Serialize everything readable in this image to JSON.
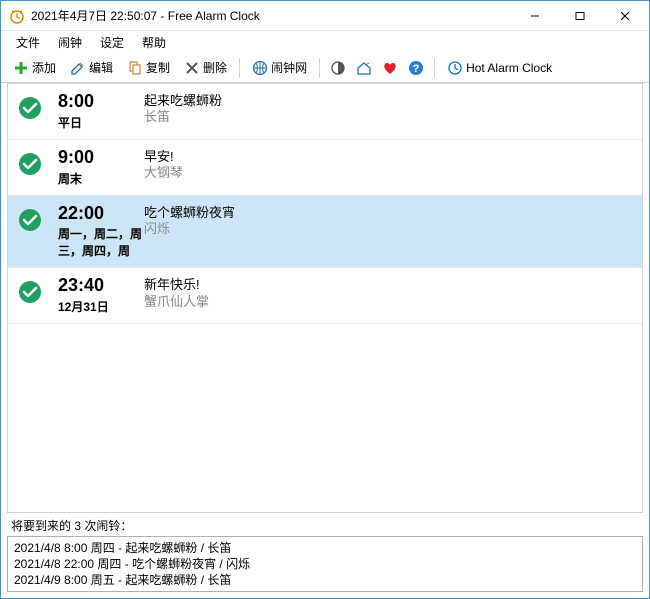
{
  "title": "2021年4月7日 22:50:07 - Free Alarm Clock",
  "menu": {
    "file": "文件",
    "alarm": "闹钟",
    "settings": "设定",
    "help": "帮助"
  },
  "toolbar": {
    "add": "添加",
    "edit": "编辑",
    "copy": "复制",
    "delete": "删除",
    "website": "闹钟网",
    "hotAlarm": "Hot Alarm Clock"
  },
  "alarms": [
    {
      "time": "8:00",
      "days": "平日",
      "title": "起来吃螺蛳粉",
      "sound": "长笛",
      "selected": false
    },
    {
      "time": "9:00",
      "days": "周末",
      "title": "早安!",
      "sound": "大钢琴",
      "selected": false
    },
    {
      "time": "22:00",
      "days": "周一，周二，周三，周四，周",
      "title": "吃个螺蛳粉夜宵",
      "sound": "闪烁",
      "selected": true
    },
    {
      "time": "23:40",
      "days": "12月31日",
      "title": "新年快乐!",
      "sound": "蟹爪仙人掌",
      "selected": false
    }
  ],
  "upcoming": {
    "label": "将要到来的 3 次闹铃：",
    "items": [
      "2021/4/8 8:00 周四 - 起来吃螺蛳粉 / 长笛",
      "2021/4/8 22:00 周四 - 吃个螺蛳粉夜宵 / 闪烁",
      "2021/4/9 8:00 周五 - 起来吃螺蛳粉 / 长笛"
    ]
  }
}
